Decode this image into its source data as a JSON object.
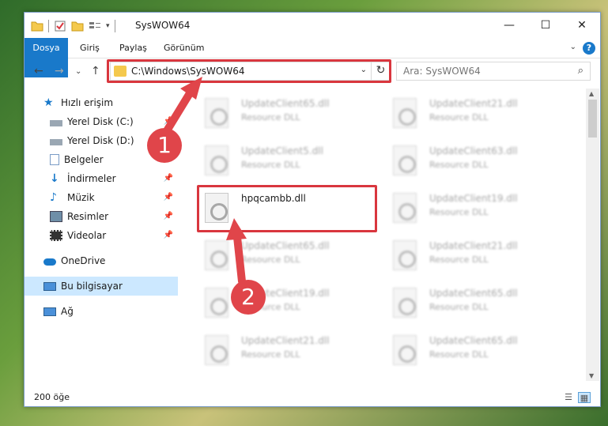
{
  "window": {
    "title": "SysWOW64",
    "controls": {
      "minimize": "—",
      "maximize": "☐",
      "close": "✕"
    }
  },
  "ribbon": {
    "tabs": [
      "Dosya",
      "Giriş",
      "Paylaş",
      "Görünüm"
    ],
    "help": "?"
  },
  "address": {
    "path": "C:\\Windows\\SysWOW64",
    "search_placeholder": "Ara: SysWOW64"
  },
  "sidebar": {
    "items": [
      {
        "label": "Hızlı erişim",
        "icon": "star-icon",
        "pinned": false
      },
      {
        "label": "Yerel Disk (C:)",
        "icon": "drive-icon",
        "pinned": true
      },
      {
        "label": "Yerel Disk (D:)",
        "icon": "drive-icon",
        "pinned": false
      },
      {
        "label": "Belgeler",
        "icon": "documents-icon",
        "pinned": false
      },
      {
        "label": "İndirmeler",
        "icon": "download-icon",
        "pinned": true
      },
      {
        "label": "Müzik",
        "icon": "music-icon",
        "pinned": true
      },
      {
        "label": "Resimler",
        "icon": "pictures-icon",
        "pinned": true
      },
      {
        "label": "Videolar",
        "icon": "video-icon",
        "pinned": true
      },
      {
        "label": "OneDrive",
        "icon": "cloud-icon",
        "pinned": false
      },
      {
        "label": "Bu bilgisayar",
        "icon": "computer-icon",
        "pinned": false,
        "selected": true
      },
      {
        "label": "Ağ",
        "icon": "network-icon",
        "pinned": false
      }
    ]
  },
  "files": {
    "left_column": [
      {
        "name": "UpdateClient65.dll",
        "type": "Resource DLL"
      },
      {
        "name": "UpdateClient5.dll",
        "type": "Resource DLL"
      },
      {
        "name": "hpqcambb.dll",
        "type": ""
      },
      {
        "name": "UpdateClient65.dll",
        "type": "Resource DLL"
      },
      {
        "name": "UpdateClient19.dll",
        "type": "Resource DLL"
      },
      {
        "name": "UpdateClient21.dll",
        "type": "Resource DLL"
      }
    ],
    "right_column": [
      {
        "name": "UpdateClient21.dll",
        "type": "Resource DLL"
      },
      {
        "name": "UpdateClient63.dll",
        "type": "Resource DLL"
      },
      {
        "name": "UpdateClient19.dll",
        "type": "Resource DLL"
      },
      {
        "name": "UpdateClient21.dll",
        "type": "Resource DLL"
      },
      {
        "name": "UpdateClient65.dll",
        "type": "Resource DLL"
      },
      {
        "name": "UpdateClient65.dll",
        "type": "Resource DLL"
      }
    ]
  },
  "status": {
    "count": "200 öğe"
  },
  "callouts": {
    "one": "1",
    "two": "2"
  },
  "colors": {
    "accent": "#1979ca",
    "highlight": "#d9363e",
    "selection": "#cce8ff"
  }
}
